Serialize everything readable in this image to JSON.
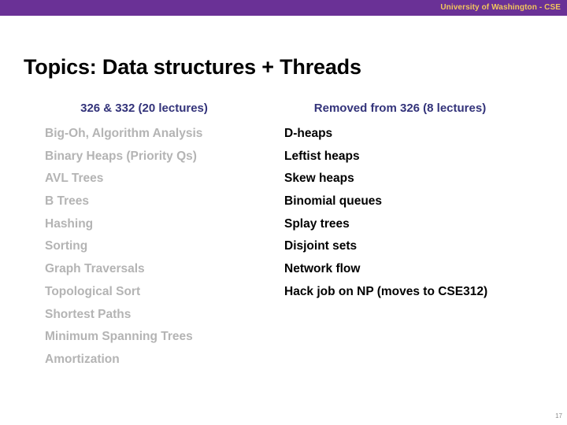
{
  "banner": {
    "label": "University of Washington - CSE",
    "background_color": "#6A3196",
    "text_color": "#F2C75C"
  },
  "title": "Topics: Data structures + Threads",
  "columns": {
    "left": {
      "heading": "326 & 332 (20 lectures)",
      "heading_color": "#33337A",
      "item_color": "#B4B4B4",
      "items": [
        "Big-Oh, Algorithm Analysis",
        "Binary Heaps (Priority Qs)",
        "AVL Trees",
        "B Trees",
        "Hashing",
        "Sorting",
        "Graph Traversals",
        "Topological Sort",
        "Shortest Paths",
        "Minimum Spanning Trees",
        "Amortization"
      ]
    },
    "right": {
      "heading": "Removed from 326 (8 lectures)",
      "heading_color": "#33337A",
      "item_color": "#000000",
      "items": [
        "D-heaps",
        "Leftist heaps",
        "Skew heaps",
        "Binomial queues",
        "Splay trees",
        "Disjoint sets",
        "Network flow",
        "Hack job on NP (moves to CSE312)"
      ]
    }
  },
  "page_number": "17"
}
